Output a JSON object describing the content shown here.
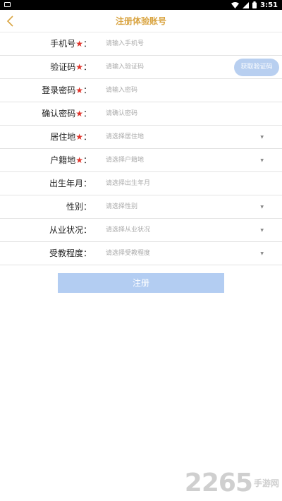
{
  "statusbar": {
    "time": "3:51"
  },
  "header": {
    "title": "注册体验账号"
  },
  "form": {
    "required_mark": "★",
    "colon": "：",
    "phone": {
      "label": "手机号",
      "placeholder": "请输入手机号"
    },
    "code": {
      "label": "验证码",
      "placeholder": "请输入验证码",
      "button": "获取验证码"
    },
    "password": {
      "label": "登录密码",
      "placeholder": "请输入密码"
    },
    "confirm": {
      "label": "确认密码",
      "placeholder": "请确认密码"
    },
    "residence": {
      "label": "居住地",
      "placeholder": "请选择居住地"
    },
    "hukou": {
      "label": "户籍地",
      "placeholder": "请选择户籍地"
    },
    "birth": {
      "label": "出生年月：",
      "placeholder": "请选择出生年月"
    },
    "gender": {
      "label": "性别：",
      "placeholder": "请选择性别"
    },
    "employment": {
      "label": "从业状况：",
      "placeholder": "请选择从业状况"
    },
    "education": {
      "label": "受教程度：",
      "placeholder": "请选择受教程度"
    },
    "arrow": "▼"
  },
  "submit_label": "注册",
  "watermark": {
    "number": "2265",
    "text": "手游网"
  },
  "colors": {
    "accent": "#d9a441",
    "button": "#b3cdf2",
    "required": "#e0342b"
  }
}
